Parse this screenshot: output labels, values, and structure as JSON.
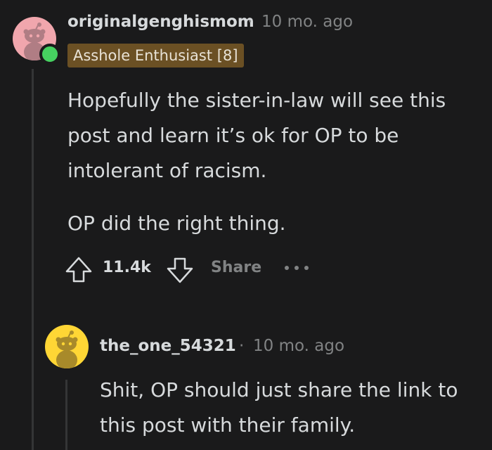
{
  "comment": {
    "username": "originalgenghismom",
    "separator": "·",
    "time": "10 mo. ago",
    "flair": "Asshole Enthusiast [8]",
    "paragraphs": [
      "Hopefully the sister-in-law will see this post and learn it’s ok for OP to be intolerant of racism.",
      "OP did the right thing."
    ],
    "score": "11.4k",
    "share_label": "Share",
    "avatar_color": "#f0a6ad",
    "online_color": "#46d160"
  },
  "reply": {
    "username": "the_one_54321",
    "separator": "·",
    "time": "10 mo. ago",
    "paragraphs": [
      "Shit, OP should just share the link to this post with their family."
    ],
    "avatar_color": "#ffd635"
  },
  "icons": {
    "upvote": "upvote-arrow-icon",
    "downvote": "downvote-arrow-icon",
    "more": "more-options-icon",
    "avatar": "snoo-avatar-icon"
  }
}
